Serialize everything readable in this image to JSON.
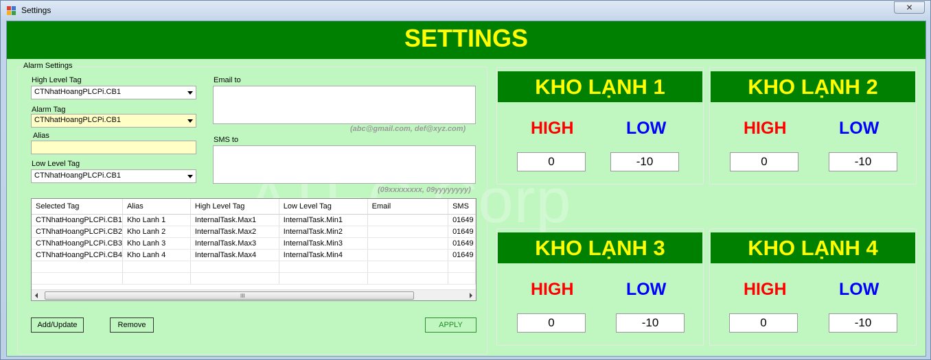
{
  "window": {
    "title": "Settings",
    "close_glyph": "✕"
  },
  "banner": {
    "title": "SETTINGS"
  },
  "watermark": "ATEC Corp",
  "alarm_settings": {
    "legend": "Alarm Settings",
    "high_level_tag_label": "High Level Tag",
    "high_level_tag_value": "CTNhatHoangPLCPi.CB1",
    "alarm_tag_label": "Alarm Tag",
    "alarm_tag_value": "CTNhatHoangPLCPi.CB1",
    "alias_label": "Alias",
    "alias_value": "",
    "low_level_tag_label": "Low Level Tag",
    "low_level_tag_value": "CTNhatHoangPLCPi.CB1",
    "email_label": "Email to",
    "email_value": "",
    "email_hint": "(abc@gmail.com, def@xyz.com)",
    "sms_label": "SMS to",
    "sms_value": "",
    "sms_hint": "(09xxxxxxxx, 09yyyyyyyy)"
  },
  "grid": {
    "columns": [
      "Selected Tag",
      "Alias",
      "High Level Tag",
      "Low Level Tag",
      "Email",
      "SMS"
    ],
    "rows": [
      [
        "CTNhatHoangPLCPi.CB1",
        "Kho Lanh 1",
        "InternalTask.Max1",
        "InternalTask.Min1",
        "",
        "01649"
      ],
      [
        "CTNhatHoangPLCPi.CB2",
        "Kho Lanh 2",
        "InternalTask.Max2",
        "InternalTask.Min2",
        "",
        "01649"
      ],
      [
        "CTNhatHoangPLCPi.CB3",
        "Kho Lanh 3",
        "InternalTask.Max3",
        "InternalTask.Min3",
        "",
        "01649"
      ],
      [
        "CTNhatHoangPLCPi.CB4",
        "Kho Lanh 4",
        "InternalTask.Max4",
        "InternalTask.Min4",
        "",
        "01649"
      ]
    ],
    "scroll_grip": "III"
  },
  "buttons": {
    "add_update": "Add/Update",
    "remove": "Remove",
    "apply": "APPLY"
  },
  "panels": [
    {
      "title": "KHO LẠNH 1",
      "high_label": "HIGH",
      "low_label": "LOW",
      "high_value": "0",
      "low_value": "-10"
    },
    {
      "title": "KHO LẠNH 2",
      "high_label": "HIGH",
      "low_label": "LOW",
      "high_value": "0",
      "low_value": "-10"
    },
    {
      "title": "KHO LẠNH 3",
      "high_label": "HIGH",
      "low_label": "LOW",
      "high_value": "0",
      "low_value": "-10"
    },
    {
      "title": "KHO LẠNH 4",
      "high_label": "HIGH",
      "low_label": "LOW",
      "high_value": "0",
      "low_value": "-10"
    }
  ],
  "colors": {
    "banner_bg": "#008000",
    "banner_text": "#ffff00",
    "client_bg": "#c0f7c0",
    "high": "#ff0000",
    "low": "#0000ff"
  }
}
